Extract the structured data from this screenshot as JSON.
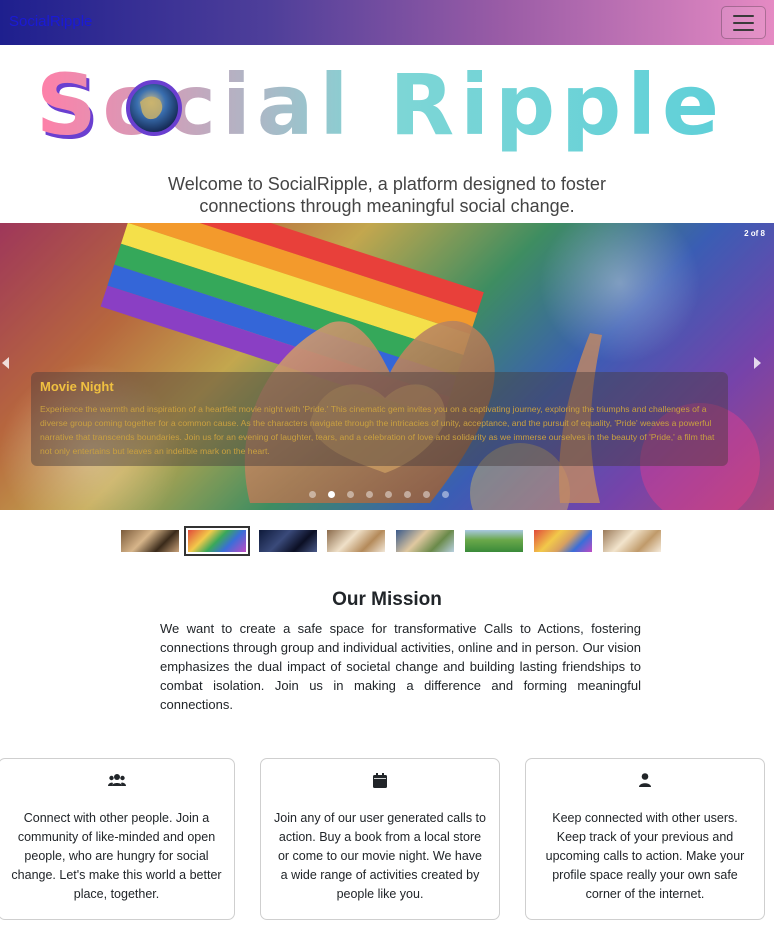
{
  "navbar": {
    "brand": "SocialRipple",
    "toggler_icon": "hamburger-icon"
  },
  "logo": {
    "text": "Social Ripple",
    "globe_icon": "globe-icon"
  },
  "intro": {
    "text": "Welcome to SocialRipple, a platform designed to foster connections through meaningful social change."
  },
  "carousel": {
    "counter": "2 of 8",
    "caption_title": "Movie Night",
    "caption_text": "Experience the warmth and inspiration of a heartfelt movie night with 'Pride.' This cinematic gem invites you on a captivating journey, exploring the triumphs and challenges of a diverse group coming together for a common cause. As the characters navigate through the intricacies of unity, acceptance, and the pursuit of equality, 'Pride' weaves a powerful narrative that transcends boundaries. Join us for an evening of laughter, tears, and a celebration of love and solidarity as we immerse ourselves in the beauty of 'Pride,' a film that not only entertains but leaves an indelible mark on the heart.",
    "slide_count": 8,
    "active_slide": 2,
    "prev_icon": "chevron-left-icon",
    "next_icon": "chevron-right-icon"
  },
  "mission": {
    "title": "Our Mission",
    "text": "We want to create a safe space for transformative Calls to Actions, fostering connections through group and individual activities, online and in person. Our vision emphasizes the dual impact of societal change and building lasting friendships to combat isolation. Join us in making a difference and forming meaningful connections."
  },
  "cards": [
    {
      "icon": "users-icon",
      "text": "Connect with other people. Join a community of like-minded and open people, who are hungry for social change. Let's make this world a better place, together."
    },
    {
      "icon": "calendar-icon",
      "text": "Join any of our user generated calls to action. Buy a book from a local store or come to our movie night. We have a wide range of activities created by people like you."
    },
    {
      "icon": "user-icon",
      "text": "Keep connected with other users. Keep track of your previous and upcoming calls to action. Make your profile space really your own safe corner of the internet."
    }
  ],
  "colors": {
    "navbar_start": "#1e1f8e",
    "navbar_end": "#e58ac3",
    "brand_text": "#1a1ad6",
    "logo_face": "#5fd3d3",
    "logo_pink": "#ef7fb5",
    "logo_purple": "#6a3fd0"
  }
}
